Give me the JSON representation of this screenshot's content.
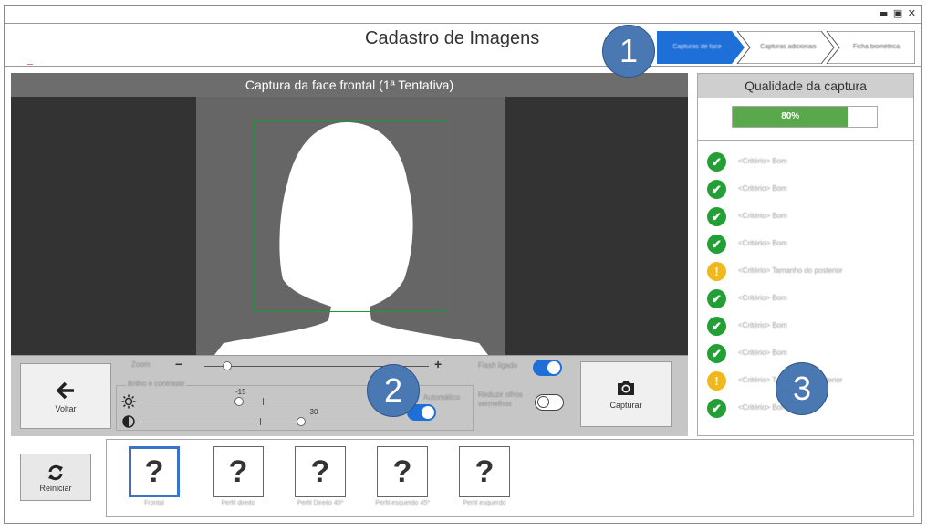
{
  "window": {
    "controls": [
      "▬",
      "▣",
      "✕"
    ]
  },
  "header": {
    "title": "Cadastro de Imagens",
    "steps": [
      {
        "label": "Capturas de face",
        "active": true
      },
      {
        "label": "Capturas adicionais",
        "active": false
      },
      {
        "label": "Ficha biométrica",
        "active": false
      }
    ]
  },
  "badges": [
    "1",
    "2",
    "3"
  ],
  "capture": {
    "title": "Captura da face frontal (1ª Tentativa)",
    "back_label": "Voltar",
    "capture_label": "Capturar",
    "zoom_label": "Zoom",
    "zoom_minus": "−",
    "zoom_plus": "+",
    "brightness_group_label": "Brilho e contraste",
    "brightness_value": "-15",
    "contrast_value": "30",
    "flash_label": "Flash ligado",
    "reduce_label": "Reduzir olhos vermelhos",
    "auto_label": "Automático",
    "flash_on": true,
    "reduce_on": false,
    "auto_on": true,
    "zoom_level": 0.1,
    "brightness_level": 0.4,
    "contrast_level": 0.65
  },
  "quality": {
    "title": "Qualidade da captura",
    "percent_label": "80%",
    "percent": 80,
    "items": [
      {
        "status": "ok",
        "text": "<Critério> Bom"
      },
      {
        "status": "ok",
        "text": "<Critério> Bom"
      },
      {
        "status": "ok",
        "text": "<Critério> Bom"
      },
      {
        "status": "ok",
        "text": "<Critério> Bom"
      },
      {
        "status": "warn",
        "text": "<Critério> Tamanho do posterior"
      },
      {
        "status": "ok",
        "text": "<Critério> Bom"
      },
      {
        "status": "ok",
        "text": "<Critério> Bom"
      },
      {
        "status": "ok",
        "text": "<Critério> Bom"
      },
      {
        "status": "warn",
        "text": "<Critério> Tamanho do posterior"
      },
      {
        "status": "ok",
        "text": "<Critério> Bom"
      }
    ]
  },
  "bottom": {
    "restart_label": "Reiniciar",
    "thumbs": [
      {
        "symbol": "?",
        "label": "Frontal",
        "active": true
      },
      {
        "symbol": "?",
        "label": "Perfil direito",
        "active": false
      },
      {
        "symbol": "?",
        "label": "Perfil Direito 45º",
        "active": false
      },
      {
        "symbol": "?",
        "label": "Perfil esquerdo 45º",
        "active": false
      },
      {
        "symbol": "?",
        "label": "Perfil esquerdo",
        "active": false
      }
    ]
  },
  "colors": {
    "accent": "#1f6fd8",
    "ok": "#23a035",
    "warn": "#f0b81c",
    "badge": "#4a78b2",
    "face_box": "#1c9a3a"
  },
  "icons": {
    "back": "arrow-left-icon",
    "camera": "camera-icon",
    "restart": "refresh-icon",
    "brightness": "sun-icon",
    "contrast": "contrast-icon",
    "ok": "check-circle-icon",
    "warn": "exclamation-circle-icon"
  }
}
